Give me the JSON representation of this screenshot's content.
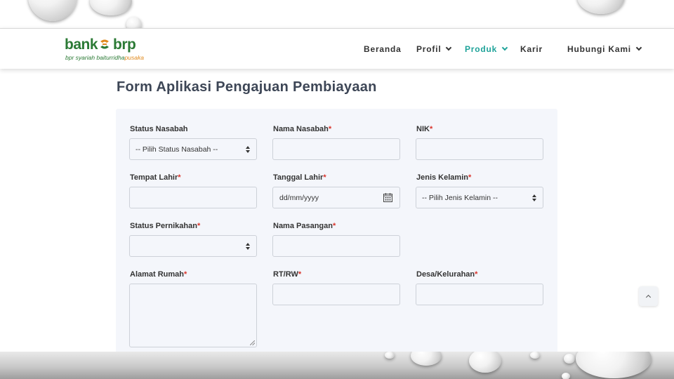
{
  "brand": {
    "name_left": "bank",
    "name_right": "brp",
    "tagline_main": "bpr syariah baiturridha",
    "tagline_accent": "pusaka",
    "color_green": "#2b7a35",
    "color_orange": "#e08a1e"
  },
  "nav": {
    "items": [
      {
        "label": "Beranda",
        "has_dropdown": false,
        "active": false
      },
      {
        "label": "Profil",
        "has_dropdown": true,
        "active": false
      },
      {
        "label": "Produk",
        "has_dropdown": true,
        "active": true
      },
      {
        "label": "Karir",
        "has_dropdown": false,
        "active": false
      },
      {
        "label": "Hubungi Kami",
        "has_dropdown": true,
        "active": false
      }
    ],
    "active_color": "#1fa39a"
  },
  "page": {
    "title": "Form Aplikasi Pengajuan Pembiayaan"
  },
  "form": {
    "required_marker": "*",
    "status_nasabah": {
      "label": "Status Nasabah",
      "value": "-- Pilih Status Nasabah --"
    },
    "nama_nasabah": {
      "label": "Nama Nasabah",
      "value": ""
    },
    "nik": {
      "label": "NIK",
      "value": ""
    },
    "tempat_lahir": {
      "label": "Tempat Lahir",
      "value": ""
    },
    "tanggal_lahir": {
      "label": "Tanggal Lahir",
      "placeholder": "dd/mm/yyyy"
    },
    "jenis_kelamin": {
      "label": "Jenis Kelamin",
      "value": "-- Pilih Jenis Kelamin --"
    },
    "status_pernikahan": {
      "label": "Status Pernikahan",
      "value": ""
    },
    "nama_pasangan": {
      "label": "Nama Pasangan",
      "value": ""
    },
    "alamat_rumah": {
      "label": "Alamat Rumah",
      "value": ""
    },
    "rt_rw": {
      "label": "RT/RW",
      "value": ""
    },
    "desa_kelurahan": {
      "label": "Desa/Kelurahan",
      "value": ""
    }
  },
  "icons": {
    "select_arrows": "sort-icon",
    "calendar": "calendar-icon",
    "dropdown": "chevron-down-icon",
    "back_to_top": "chevron-up-icon"
  }
}
